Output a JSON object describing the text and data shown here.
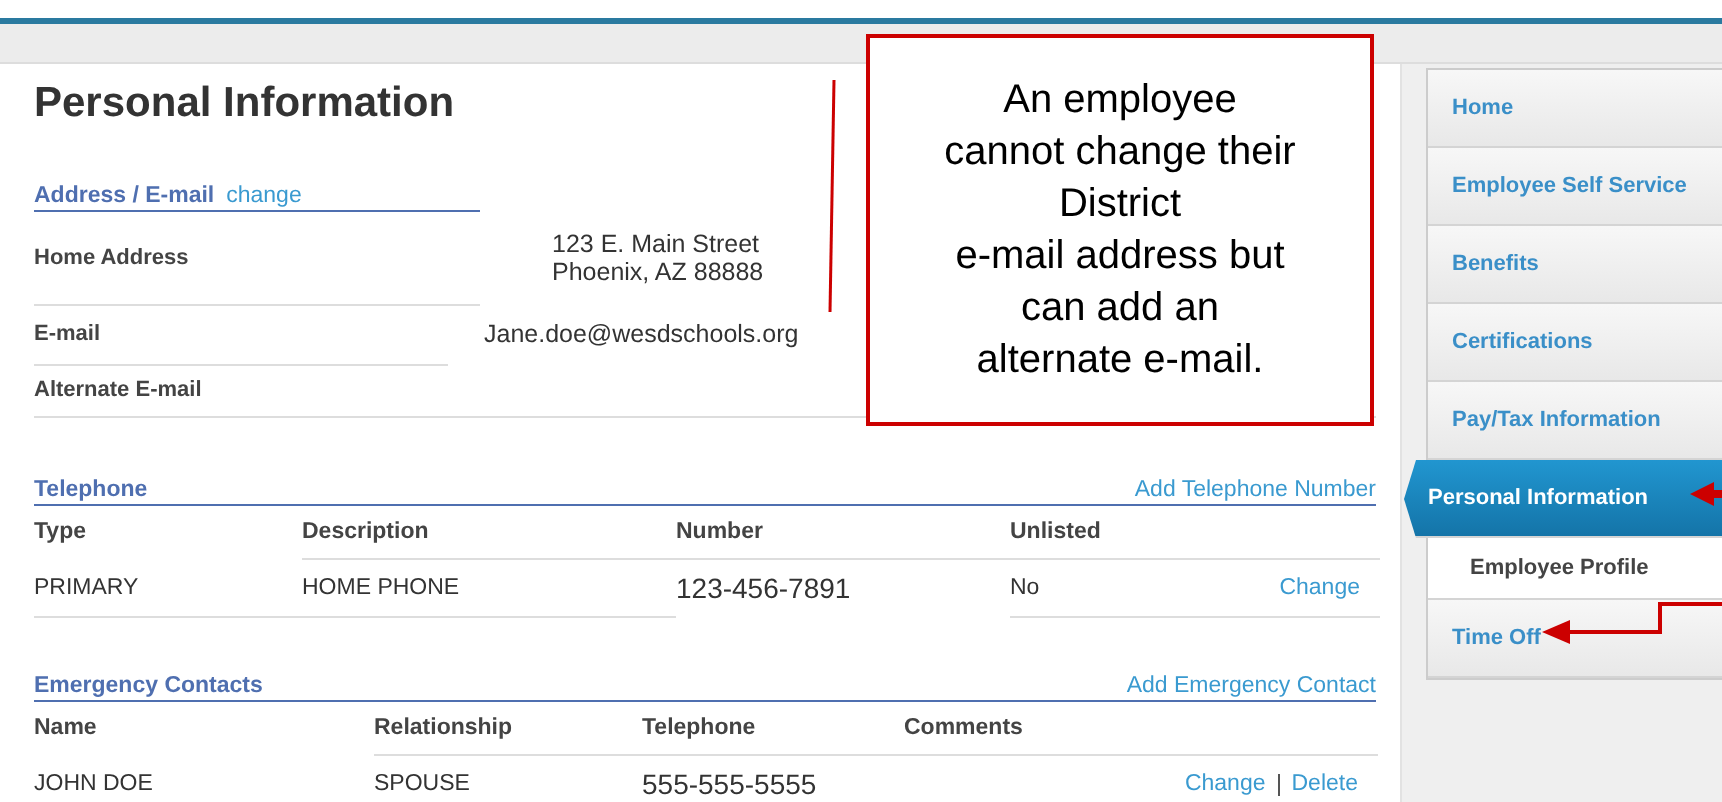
{
  "page_title": "Personal Information",
  "address_section": {
    "title": "Address / E-mail",
    "link": "change",
    "rows": [
      {
        "label": "Home Address",
        "value_lines": [
          "123 E. Main Street",
          "Phoenix, AZ 88888"
        ]
      },
      {
        "label": "E-mail",
        "value_lines": [
          "Jane.doe@wesdschools.org"
        ]
      },
      {
        "label": "Alternate E-mail",
        "value_lines": []
      }
    ]
  },
  "telephone": {
    "title": "Telephone",
    "link": "Add Telephone Number",
    "columns": [
      "Type",
      "Description",
      "Number",
      "Unlisted"
    ],
    "rows": [
      {
        "cells": [
          "PRIMARY",
          "HOME PHONE",
          "123-456-7891",
          "No"
        ],
        "actions": [
          "Change"
        ]
      }
    ]
  },
  "emergency": {
    "title": "Emergency Contacts",
    "link": "Add Emergency Contact",
    "columns": [
      "Name",
      "Relationship",
      "Telephone",
      "Comments"
    ],
    "rows": [
      {
        "cells": [
          "JOHN DOE",
          "SPOUSE",
          "555-555-5555",
          ""
        ],
        "actions": [
          "Change",
          "Delete"
        ]
      }
    ]
  },
  "sidebar": {
    "items": [
      {
        "label": "Home",
        "selected": false
      },
      {
        "label": "Employee Self Service",
        "selected": false
      },
      {
        "label": "Benefits",
        "selected": false
      },
      {
        "label": "Certifications",
        "selected": false
      },
      {
        "label": "Pay/Tax Information",
        "selected": false
      },
      {
        "label": "Personal Information",
        "selected": true,
        "children": [
          {
            "label": "Employee Profile",
            "selected": false
          }
        ]
      },
      {
        "label": "Time Off",
        "selected": false
      }
    ]
  },
  "callout": {
    "lines": [
      "An employee",
      "cannot change their",
      "District",
      "e-mail address but",
      "can add an",
      "alternate e-mail."
    ]
  }
}
